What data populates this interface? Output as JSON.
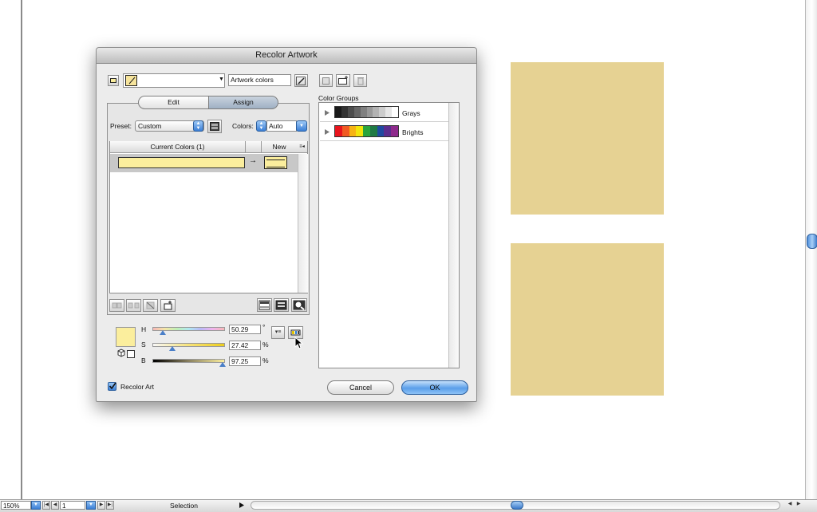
{
  "dialog": {
    "title": "Recolor Artwork",
    "color_group_name": "Artwork colors",
    "tabs": [
      {
        "label": "Edit"
      },
      {
        "label": "Assign"
      }
    ],
    "active_tab": "Assign",
    "preset_label": "Preset:",
    "preset_value": "Custom",
    "colors_label": "Colors:",
    "colors_value": "Auto",
    "current_colors_header": "Current Colors (1)",
    "new_header": "New",
    "current_color_hex": "#fbee9d",
    "arrow": "→",
    "hsb": {
      "h_label": "H",
      "h_value": "50.29",
      "h_unit": "°",
      "h_fraction": 0.14,
      "s_label": "S",
      "s_value": "27.42",
      "s_unit": "%",
      "s_fraction": 0.27,
      "b_label": "B",
      "b_value": "97.25",
      "b_unit": "%",
      "b_fraction": 0.97
    },
    "recolor_art_label": "Recolor Art",
    "recolor_art_checked": true,
    "color_groups_label": "Color Groups",
    "color_groups": [
      {
        "name": "Grays",
        "swatches": [
          "#1a1a1a",
          "#333333",
          "#4d4d4d",
          "#666666",
          "#808080",
          "#999999",
          "#b3b3b3",
          "#cccccc",
          "#e6e6e6",
          "#ffffff"
        ]
      },
      {
        "name": "Brights",
        "swatches": [
          "#e8141c",
          "#f15a22",
          "#f7b313",
          "#f2e50b",
          "#2aa53c",
          "#1f7a44",
          "#1f4aa0",
          "#5b2d8e",
          "#8e2a8c"
        ]
      }
    ],
    "cancel_label": "Cancel",
    "ok_label": "OK"
  },
  "canvas": {
    "swatch_color": "#e6d293"
  },
  "statusbar": {
    "zoom": "150%",
    "artboard": "1",
    "tool": "Selection"
  },
  "colors": {
    "accent": "#3b7fd6"
  }
}
